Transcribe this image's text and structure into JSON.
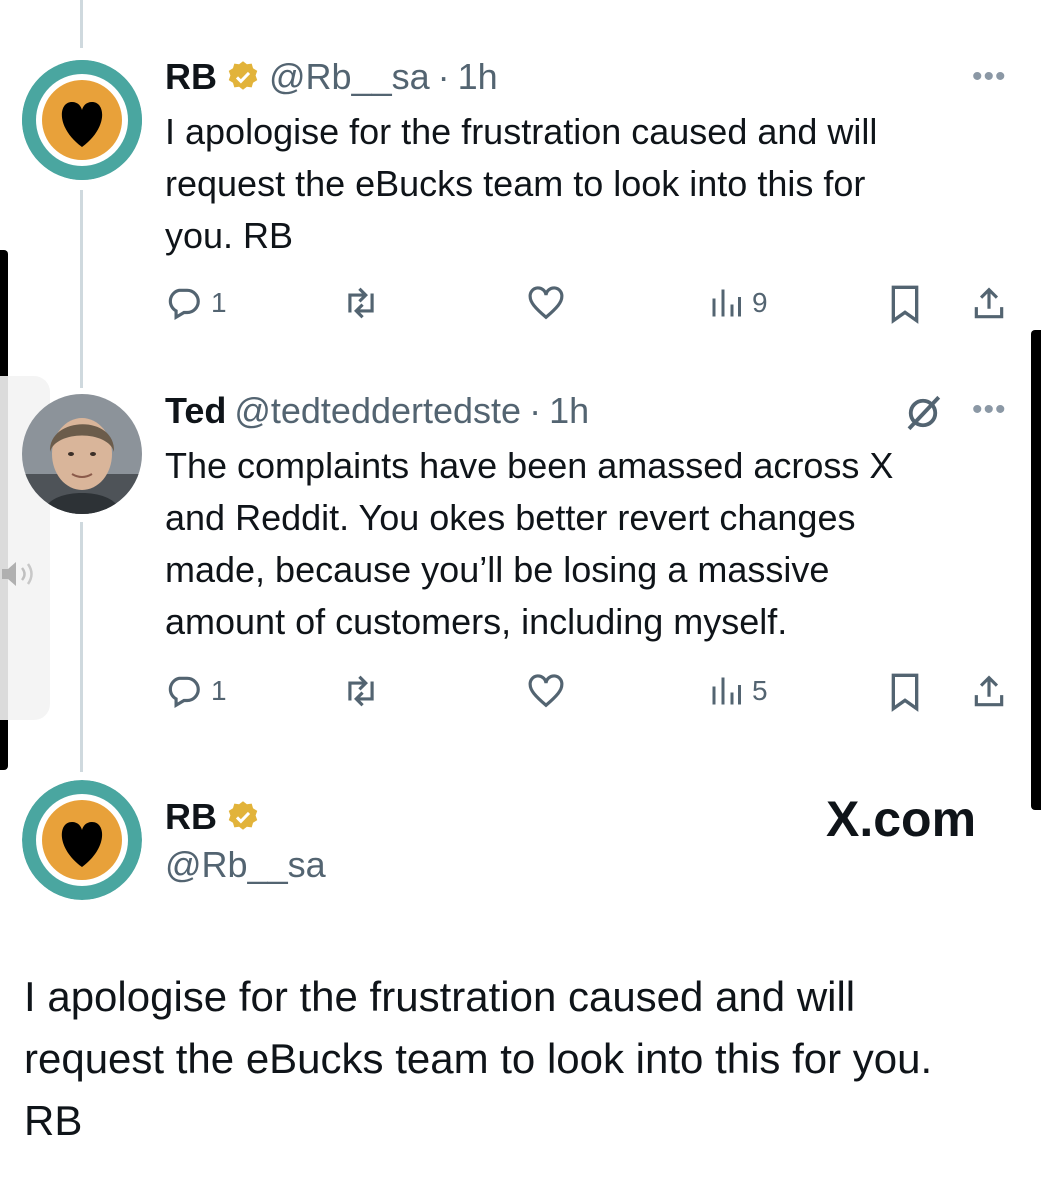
{
  "tweets": [
    {
      "name": "RB",
      "handle": "@Rb__sa",
      "time": "1h",
      "text_lines": [
        "I apologise for the frustration caused and will",
        "request the eBucks team to look into this for",
        "you. RB"
      ],
      "replies": "1",
      "views": "9"
    },
    {
      "name": "Ted",
      "handle": "@tedteddertedste",
      "time": "1h",
      "text_lines": [
        "The complaints have been amassed across X",
        "and Reddit. You okes better revert changes",
        "made, because you’ll be losing a massive",
        "amount of customers, including myself."
      ],
      "replies": "1",
      "views": "5"
    }
  ],
  "card": {
    "name": "RB",
    "handle": "@Rb__sa",
    "brand": "X.com",
    "text_lines": [
      "I apologise for the frustration caused and will",
      "request the eBucks team to look into this for you.",
      "RB"
    ]
  },
  "colors": {
    "teal": "#4aa6a0",
    "orange": "#e8a13a",
    "verified_gold": "#e2b33a",
    "secondary_text": "#536471",
    "thread_line": "#cfd9de"
  },
  "icons": [
    "verified-badge-icon",
    "more-icon",
    "reply-icon",
    "retweet-icon",
    "like-icon",
    "views-icon",
    "bookmark-icon",
    "share-icon",
    "grok-icon",
    "volume-icon",
    "heart-icon"
  ]
}
